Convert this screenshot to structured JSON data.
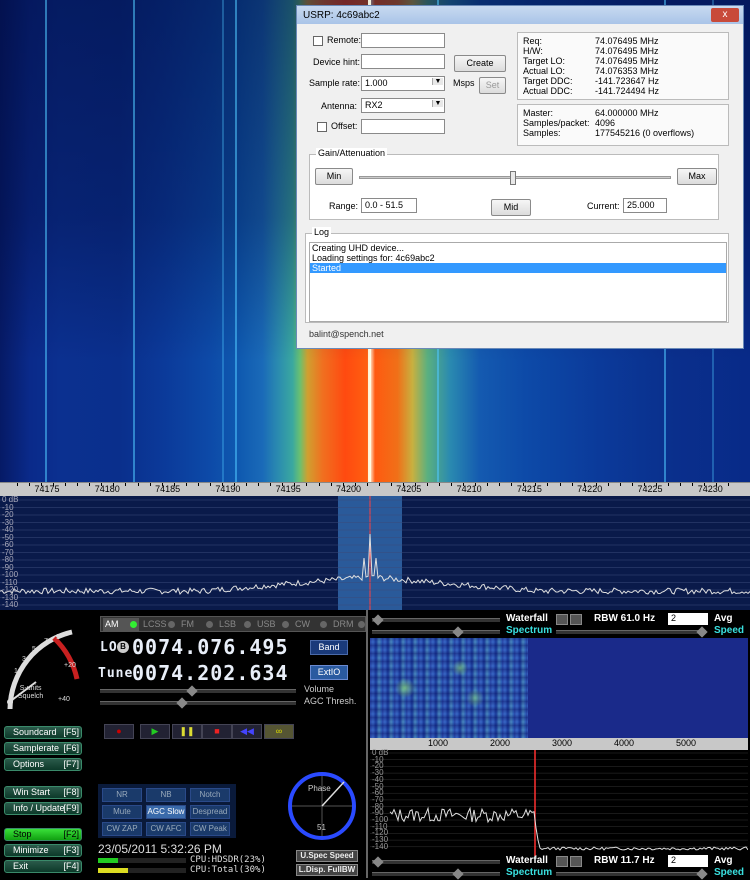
{
  "freq_scale": [
    "74175",
    "74180",
    "74185",
    "74190",
    "74195",
    "74200",
    "74205",
    "74210",
    "74215",
    "74220",
    "74225",
    "74230"
  ],
  "spec_db": [
    "0 dB",
    "-10",
    "-20",
    "-30",
    "-40",
    "-50",
    "-60",
    "-70",
    "-80",
    "-90",
    "-100",
    "-110",
    "-120",
    "-130",
    "-140"
  ],
  "dialog": {
    "title": "USRP: 4c69abc2",
    "close": "x",
    "remote_label": "Remote:",
    "device_hint_label": "Device hint:",
    "create_button": "Create",
    "sample_rate_label": "Sample rate:",
    "sample_rate_value": "1.000",
    "msps": "Msps",
    "set_button": "Set",
    "antenna_label": "Antenna:",
    "antenna_value": "RX2",
    "offset_label": "Offset:",
    "info": [
      {
        "k": "Req:",
        "v": "74.076495 MHz"
      },
      {
        "k": "H/W:",
        "v": "74.076495 MHz"
      },
      {
        "k": "Target LO:",
        "v": "74.076495 MHz"
      },
      {
        "k": "Actual LO:",
        "v": "74.076353 MHz"
      },
      {
        "k": "Target DDC:",
        "v": "-141.723647 Hz"
      },
      {
        "k": "Actual DDC:",
        "v": "-141.724494 Hz"
      }
    ],
    "info2": [
      {
        "k": "Master:",
        "v": "64.000000 MHz"
      },
      {
        "k": "Samples/packet:",
        "v": "4096"
      },
      {
        "k": "Samples:",
        "v": "177545216 (0 overflows)"
      }
    ],
    "gain_group": "Gain/Attenuation",
    "min_button": "Min",
    "max_button": "Max",
    "mid_button": "Mid",
    "range_label": "Range:",
    "range_value": "0.0 - 51.5",
    "current_label": "Current:",
    "current_value": "25.000",
    "log_group": "Log",
    "log_lines": [
      "Creating UHD device...",
      "Loading settings for: 4c69abc2",
      "Started"
    ],
    "footer": "balint@spench.net"
  },
  "meter": {
    "ticks": [
      "1",
      "3",
      "5",
      "7",
      "9",
      "+20",
      "+40"
    ],
    "s_label": "S-units",
    "sq_label": "Squelch"
  },
  "modes": [
    "AM",
    "LCSS",
    "FM",
    "LSB",
    "USB",
    "CW",
    "DRM"
  ],
  "lo_label": "LO",
  "lo_badge": "B",
  "lo_value": "0074.076.495",
  "tune_label": "Tune",
  "tune_value": "0074.202.634",
  "band_button": "Band",
  "extio_button": "ExtIO",
  "volume_label": "Volume",
  "agc_thresh_label": "AGC Thresh.",
  "left_buttons": [
    {
      "label": "Soundcard",
      "key": "[F5]"
    },
    {
      "label": "Samplerate",
      "key": "[F6]"
    },
    {
      "label": "Options",
      "key": "[F7]"
    },
    {
      "label": "Win Start",
      "key": "[F8]"
    },
    {
      "label": "Info / Update",
      "key": "[F9]"
    },
    {
      "label": "Stop",
      "key": "[F2]"
    },
    {
      "label": "Minimize",
      "key": "[F3]"
    },
    {
      "label": "Exit",
      "key": "[F4]"
    }
  ],
  "transport": {
    "record": "●",
    "play": "▶",
    "pause": "❚❚",
    "stop": "■",
    "rewind": "◀◀",
    "loop": "∞"
  },
  "dsp_buttons": [
    "NR",
    "NB",
    "Notch",
    "Mute",
    "AGC Slow",
    "Despread",
    "CW ZAP",
    "CW AFC",
    "CW Peak"
  ],
  "datetime": "23/05/2011 5:32:26 PM",
  "cpu1": "CPU:HDSDR(23%)",
  "cpu2": "CPU:Total(30%)",
  "phase_label": "Phase",
  "phase_value": "51",
  "uspec_speed": "U.Spec Speed",
  "ldisp_fullbw": "L.Disp. FullBW",
  "waterfall_label": "Waterfall",
  "spectrum_label": "Spectrum",
  "rbw_top": "RBW 61.0 Hz",
  "rbw_bottom": "RBW 11.7 Hz",
  "avg_value": "2",
  "avg_label": "Avg",
  "speed_label": "Speed",
  "audio_scale": [
    "1000",
    "2000",
    "3000",
    "4000",
    "5000"
  ],
  "audio_db": [
    "0 dB",
    "-10",
    "-20",
    "-30",
    "-40",
    "-50",
    "-60",
    "-70",
    "-80",
    "-90",
    "-100",
    "-110",
    "-120",
    "-130",
    "-140"
  ]
}
